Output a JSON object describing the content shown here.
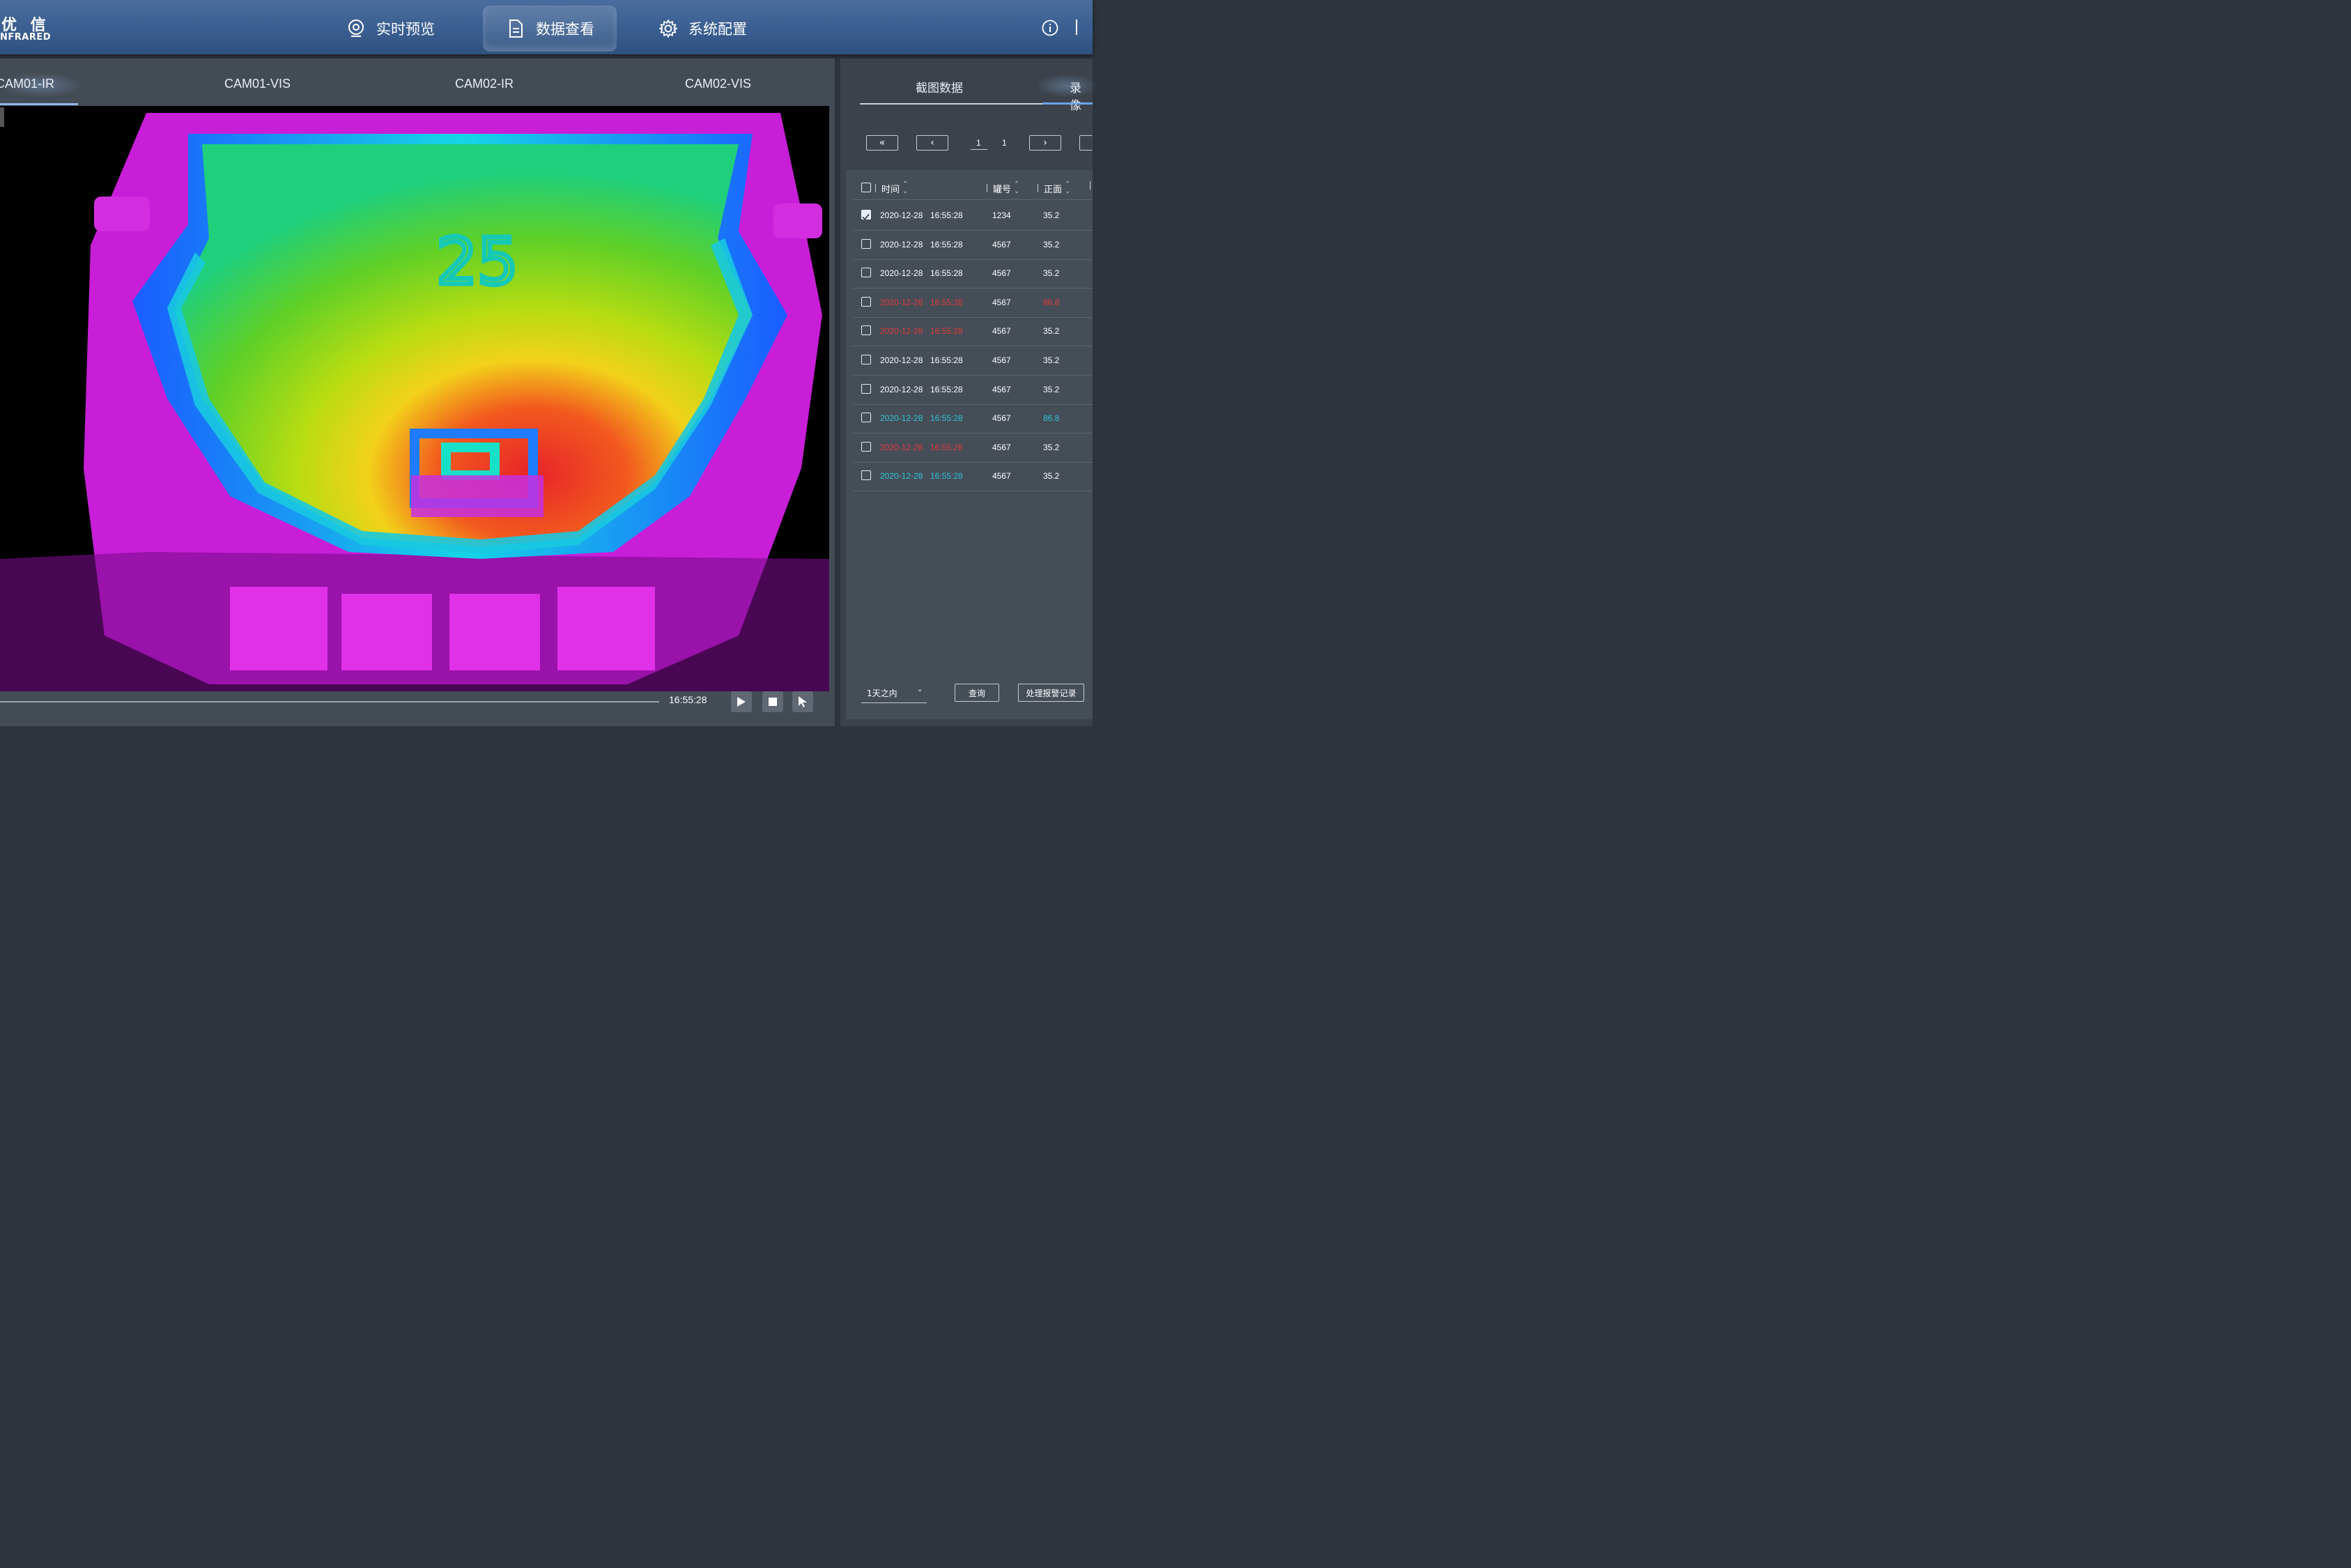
{
  "brand": {
    "name_cn": "优 信",
    "name_en": "NFRARED"
  },
  "nav": [
    {
      "label": "实时预览",
      "icon": "camera-icon"
    },
    {
      "label": "数据查看",
      "icon": "document-icon",
      "active": true
    },
    {
      "label": "系统配置",
      "icon": "gear-icon"
    }
  ],
  "camera_tabs": [
    "CAM01-IR",
    "CAM01-VIS",
    "CAM02-IR",
    "CAM02-VIS"
  ],
  "active_camera_tab": "CAM01-IR",
  "thermal_image": {
    "overlay_number": "25"
  },
  "player": {
    "time": "16:55:28"
  },
  "right_tabs": [
    "截图数据",
    "录像"
  ],
  "pagination": {
    "current": "1",
    "total": "1"
  },
  "table": {
    "headers": [
      "时间",
      "罐号",
      "正面"
    ],
    "rows": [
      {
        "date": "2020-12-28",
        "time": "16:55:28",
        "tank": "1234",
        "front": "35.2",
        "checked": true,
        "timeColor": "normal",
        "valColor": "normal"
      },
      {
        "date": "2020-12-28",
        "time": "16:55:28",
        "tank": "4567",
        "front": "35.2",
        "checked": false,
        "timeColor": "normal",
        "valColor": "normal"
      },
      {
        "date": "2020-12-28",
        "time": "16:55:28",
        "tank": "4567",
        "front": "35.2",
        "checked": false,
        "timeColor": "normal",
        "valColor": "normal"
      },
      {
        "date": "2020-12-28",
        "time": "16:55:28",
        "tank": "4567",
        "front": "86.8",
        "checked": false,
        "timeColor": "red",
        "valColor": "red"
      },
      {
        "date": "2020-12-28",
        "time": "16:55:28",
        "tank": "4567",
        "front": "35.2",
        "checked": false,
        "timeColor": "red",
        "valColor": "normal"
      },
      {
        "date": "2020-12-28",
        "time": "16:55:28",
        "tank": "4567",
        "front": "35.2",
        "checked": false,
        "timeColor": "normal",
        "valColor": "normal"
      },
      {
        "date": "2020-12-28",
        "time": "16:55:28",
        "tank": "4567",
        "front": "35.2",
        "checked": false,
        "timeColor": "normal",
        "valColor": "normal"
      },
      {
        "date": "2020-12-28",
        "time": "16:55:28",
        "tank": "4567",
        "front": "86.8",
        "checked": false,
        "timeColor": "cyan",
        "valColor": "cyan"
      },
      {
        "date": "2020-12-28",
        "time": "16:55:28",
        "tank": "4567",
        "front": "35.2",
        "checked": false,
        "timeColor": "red",
        "valColor": "normal"
      },
      {
        "date": "2020-12-28",
        "time": "16:55:28",
        "tank": "4567",
        "front": "35.2",
        "checked": false,
        "timeColor": "cyan",
        "valColor": "normal"
      }
    ]
  },
  "filter": {
    "range": "1天之内",
    "query_label": "查询",
    "alarm_label": "处理报警记录"
  },
  "colors": {
    "accent": "#6aa5ea",
    "alarm": "#e23b3b",
    "highlight": "#2ec4d6"
  }
}
